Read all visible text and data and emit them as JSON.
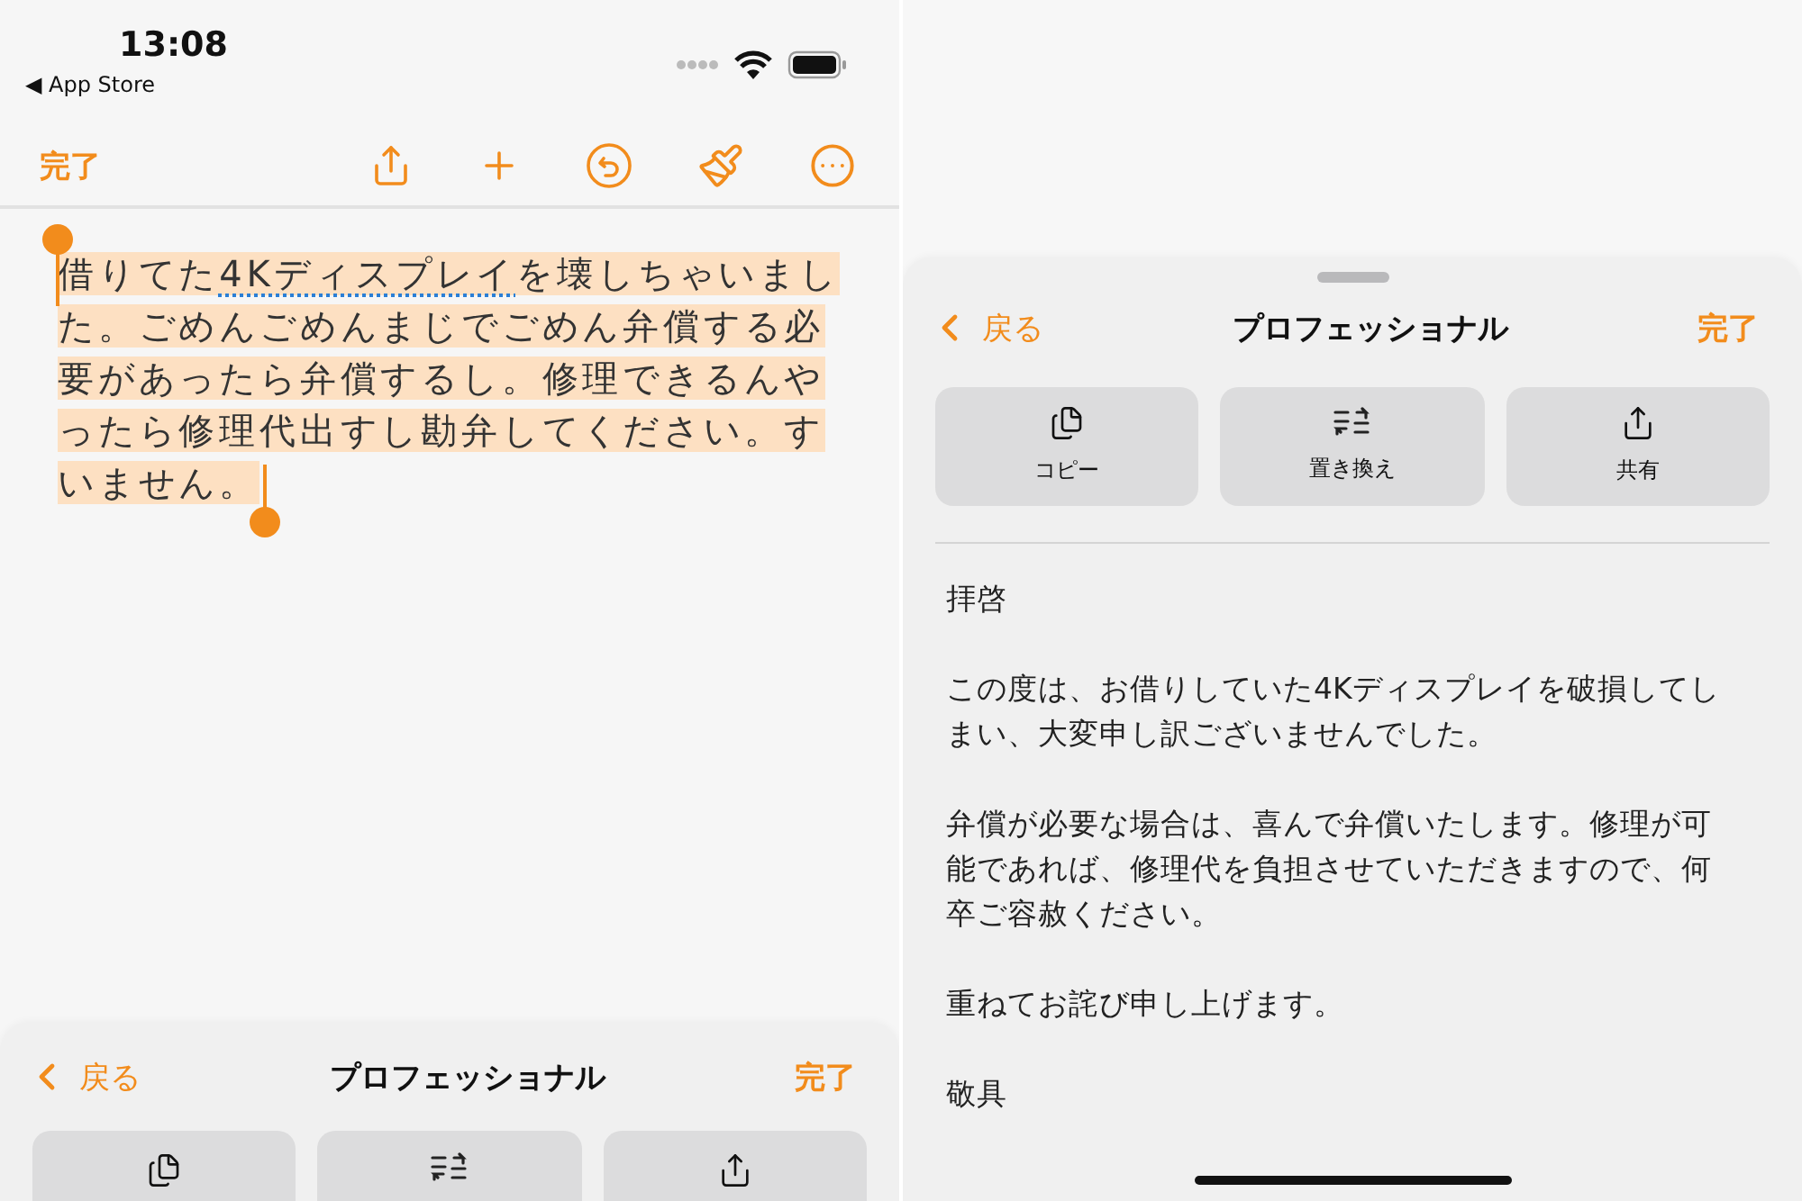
{
  "left_screen": {
    "status_bar": {
      "time": "13:08",
      "back_link": "◀ App Store"
    },
    "toolbar": {
      "done": "完了",
      "tools": [
        {
          "kind": "share"
        },
        {
          "kind": "add"
        },
        {
          "kind": "undo"
        },
        {
          "kind": "brush"
        },
        {
          "kind": "more"
        }
      ]
    },
    "note": {
      "selected": true,
      "segments": [
        {
          "text": "借りてた",
          "flagged": false
        },
        {
          "text": "4Kディスプレイ",
          "flagged": true
        },
        {
          "text": "を壊しちゃいました。ごめんごめんまじでごめん弁償する必要があったら弁償するし。修理できるんやったら修理代出すし勘弁してください。すいません。",
          "flagged": false
        }
      ]
    },
    "sheet": {
      "back": "戻る",
      "title": "プロフェッショナル",
      "done": "完了",
      "buttons": [
        {
          "kind": "copy"
        },
        {
          "kind": "replace"
        },
        {
          "kind": "share"
        }
      ]
    }
  },
  "right_screen": {
    "sheet": {
      "back": "戻る",
      "title": "プロフェッショナル",
      "done": "完了",
      "buttons": [
        {
          "kind": "copy",
          "label": "コピー"
        },
        {
          "kind": "replace",
          "label": "置き換え"
        },
        {
          "kind": "share",
          "label": "共有"
        }
      ]
    },
    "result": {
      "paragraphs": [
        "拝啓",
        "この度は、お借りしていた4Kディスプレイを破損してしまい、大変申し訳ございませんでした。",
        "弁償が必要な場合は、喜んで弁償いたします。修理が可能であれば、修理代を負担させていただきますので、何卒ご容赦ください。",
        "重ねてお詫び申し上げます。",
        "敬具"
      ]
    }
  }
}
